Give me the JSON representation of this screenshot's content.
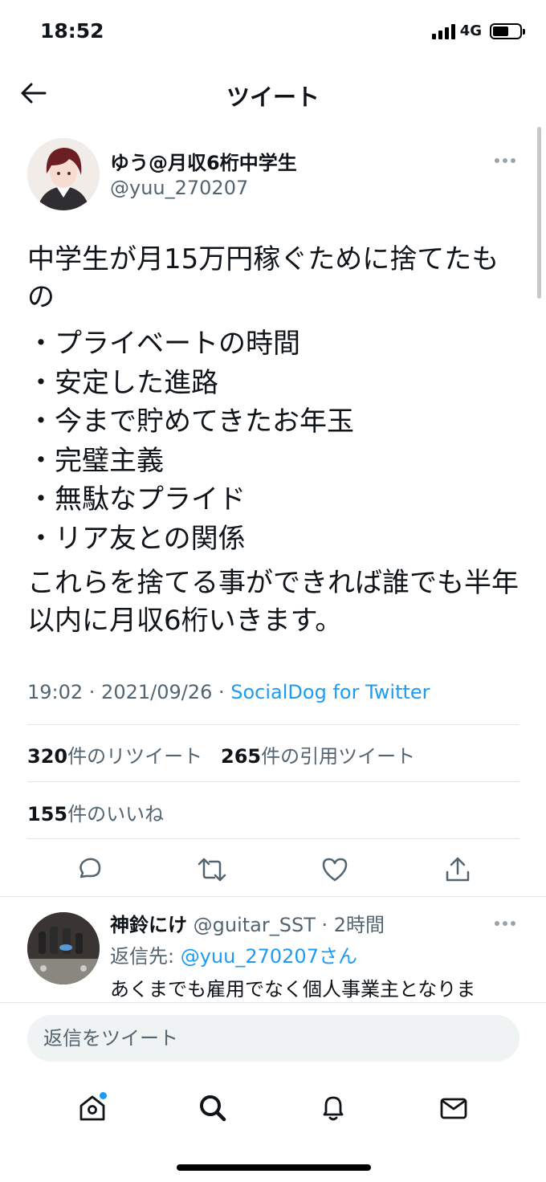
{
  "status_bar": {
    "time": "18:52",
    "network": "4G",
    "battery_level": 0.6
  },
  "header": {
    "title": "ツイート",
    "back_icon": "arrow-left-icon"
  },
  "tweet": {
    "author": {
      "name": "ゆう@月収6桁中学生",
      "handle": "@yuu_270207"
    },
    "text_intro": "中学生が月15万円稼ぐために捨てたもの",
    "list_items": [
      "・プライベートの時間",
      "・安定した進路",
      "・今まで貯めてきたお年玉",
      "・完璧主義",
      "・無駄なプライド",
      "・リア友との関係"
    ],
    "text_outro": "これらを捨てる事ができれば誰でも半年以内に月収6桁いきます。",
    "timestamp": "19:02 · 2021/09/26 · ",
    "source": "SocialDog for Twitter",
    "stats": {
      "retweets_count": "320",
      "retweets_label": "件のリツイート",
      "quotes_count": "265",
      "quotes_label": "件の引用ツイート",
      "likes_count": "155",
      "likes_label": "件のいいね"
    },
    "actions": [
      {
        "name": "reply-icon"
      },
      {
        "name": "retweet-icon"
      },
      {
        "name": "like-icon"
      },
      {
        "name": "share-icon"
      }
    ]
  },
  "reply": {
    "name": "神鈴にけ",
    "handle": " @guitar_SST",
    "age": " · 2時間",
    "reply_to_label": "返信先: ",
    "reply_to_handle": "@yuu_270207さん",
    "text": "あくまでも雇用でなく個人事業主となりま"
  },
  "composer": {
    "placeholder": "返信をツイート"
  },
  "tabbar": {
    "tabs": [
      "home-icon",
      "search-icon",
      "notifications-icon",
      "messages-icon"
    ]
  },
  "colors": {
    "accent": "#1d9bf0",
    "secondary_text": "#536471",
    "divider": "#e1e6ea"
  }
}
